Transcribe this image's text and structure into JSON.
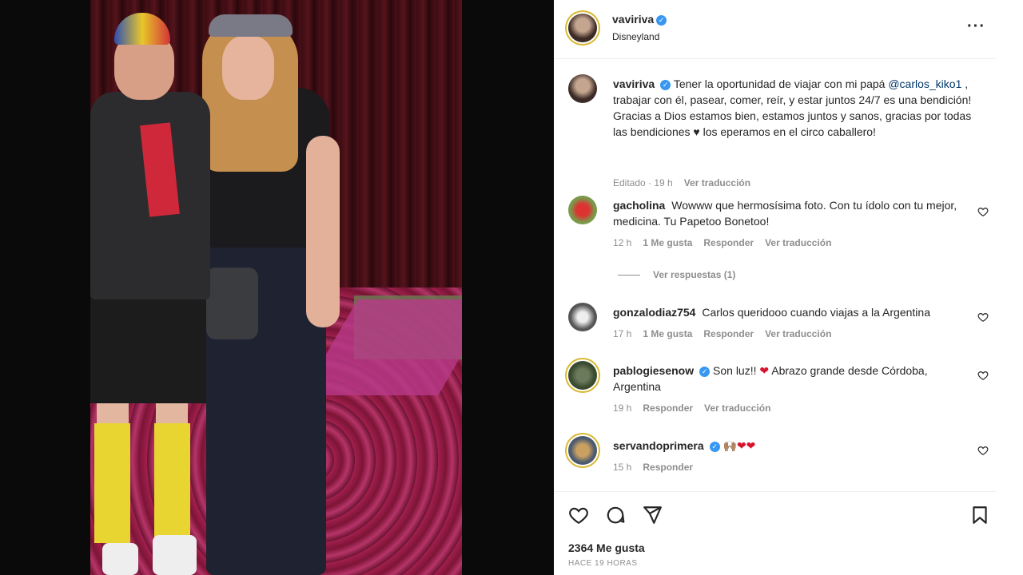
{
  "post": {
    "username": "vaviriva",
    "location": "Disneyland",
    "caption_mention": "@carlos_kiko1",
    "caption_part1": "Tener la oportunidad de viajar con mi papá",
    "caption_part2": ", trabajar con él, pasear, comer, reír, y estar juntos 24/7 es una bendición! Gracias a Dios estamos bien, estamos juntos y sanos, gracias por todas las bendiciones",
    "caption_heart": "♥",
    "caption_part3": "los eperamos en el circo caballero!",
    "caption_meta_edited": "Editado · 19 h",
    "caption_meta_translate": "Ver traducción",
    "likes": "2364 Me gusta",
    "posted_ago": "HACE 19 HORAS"
  },
  "comments": [
    {
      "username": "gacholina",
      "text": "Wowww que hermosísima foto. Con tu ídolo con tu mejor, medicina. Tu Papetoo Bonetoo!",
      "time": "12 h",
      "likes": "1 Me gusta",
      "reply": "Responder",
      "translate": "Ver traducción",
      "view_replies": "Ver respuestas (1)"
    },
    {
      "username": "gonzalodiaz754",
      "text": "Carlos queridooo cuando viajas a la Argentina",
      "time": "17 h",
      "likes": "1 Me gusta",
      "reply": "Responder",
      "translate": "Ver traducción"
    },
    {
      "username": "pablogiesenow",
      "text_a": "Son luz!!",
      "text_b": "Abrazo grande desde Córdoba, Argentina",
      "time": "19 h",
      "reply": "Responder",
      "translate": "Ver traducción"
    },
    {
      "username": "servandoprimera",
      "emoji": "🙌🏽",
      "time": "15 h",
      "reply": "Responder"
    }
  ],
  "icons": {
    "more": "more-options-icon",
    "like": "heart-icon",
    "comment": "comment-icon",
    "share": "paper-plane-icon",
    "save": "bookmark-icon"
  },
  "colors": {
    "link": "#00376b",
    "verified": "#3897f0",
    "heart_red": "#d8122c",
    "meta_gray": "#8e8e8e"
  }
}
